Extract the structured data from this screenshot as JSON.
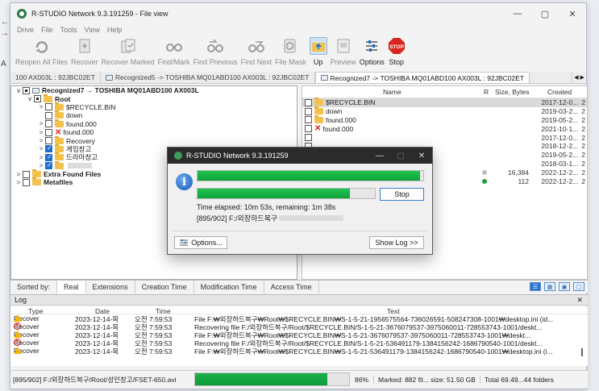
{
  "background": {
    "left_labels": [
      "←",
      "→",
      "A"
    ]
  },
  "window": {
    "title": "R-STUDIO Network 9.3.191259 - File view",
    "controls": {
      "min": "—",
      "max": "▢",
      "close": "✕"
    }
  },
  "menu": [
    "Drive",
    "File",
    "Tools",
    "View",
    "Help"
  ],
  "toolbar": [
    {
      "label": "Reopen All Files",
      "icon": "reopen-icon",
      "enabled": false
    },
    {
      "label": "Recover",
      "icon": "recover-icon",
      "enabled": false
    },
    {
      "label": "Recover Marked",
      "icon": "recover-marked-icon",
      "enabled": false
    },
    {
      "label": "Find/Mark",
      "icon": "find-mark-icon",
      "enabled": false
    },
    {
      "label": "Find Previous",
      "icon": "find-previous-icon",
      "enabled": false
    },
    {
      "label": "Find Next",
      "icon": "find-next-icon",
      "enabled": false
    },
    {
      "label": "File Mask",
      "icon": "file-mask-icon",
      "enabled": false
    },
    {
      "label": "Up",
      "icon": "up-folder-icon",
      "enabled": true
    },
    {
      "label": "Preview",
      "icon": "preview-icon",
      "enabled": false
    },
    {
      "label": "Options",
      "icon": "options-icon",
      "enabled": true
    },
    {
      "label": "Stop",
      "icon": "stop-icon",
      "enabled": true
    }
  ],
  "tabs": [
    {
      "label": "100 AX003L : 92JBC02ET",
      "active": false
    },
    {
      "label": "Recognized5 -> TOSHIBA MQ01ABD100 AX003L : 92JBC02ET",
      "active": false
    },
    {
      "label": "Recognized7 -> TOSHIBA MQ01ABD100 AX003L : 92JBC02ET",
      "active": true
    }
  ],
  "tab_nav": "◀ ▶",
  "tree": [
    {
      "label": "Recognized7 → TOSHIBA MQ01ABD100 AX003L",
      "indent": 0,
      "expander": "∨",
      "check": "part",
      "type": "drive",
      "bold": true
    },
    {
      "label": "Root",
      "indent": 1,
      "expander": "∨",
      "check": "part",
      "type": "folder",
      "bold": true
    },
    {
      "label": "$RECYCLE.BIN",
      "indent": 2,
      "expander": ">",
      "check": "none",
      "type": "folder"
    },
    {
      "label": "down",
      "indent": 2,
      "expander": "",
      "check": "none",
      "type": "folder"
    },
    {
      "label": "found.000",
      "indent": 2,
      "expander": ">",
      "check": "none",
      "type": "folder"
    },
    {
      "label": "found.000",
      "indent": 2,
      "expander": ">",
      "check": "none",
      "type": "deleted"
    },
    {
      "label": "Recovery",
      "indent": 2,
      "expander": ">",
      "check": "none",
      "type": "folder"
    },
    {
      "label": "게임창고",
      "indent": 2,
      "expander": ">",
      "check": "checked",
      "type": "folder"
    },
    {
      "label": "드라마창고",
      "indent": 2,
      "expander": ">",
      "check": "checked",
      "type": "folder"
    },
    {
      "label": "",
      "indent": 2,
      "expander": ">",
      "check": "checked",
      "type": "folder-blur"
    },
    {
      "label": "Extra Found Files",
      "indent": 0,
      "expander": ">",
      "check": "none",
      "type": "folder",
      "bold": true
    },
    {
      "label": "Metafiles",
      "indent": 0,
      "expander": ">",
      "check": "none",
      "type": "folder",
      "bold": true
    }
  ],
  "columns": {
    "name": "Name",
    "r": "R",
    "size": "Size, Bytes",
    "created": "Created"
  },
  "files": [
    {
      "name": "$RECYCLE.BIN",
      "size": "",
      "created": "2017-12-0...",
      "extra": "2",
      "type": "folder",
      "selected": true
    },
    {
      "name": "down",
      "size": "",
      "created": "2019-03-2...",
      "extra": "2",
      "type": "folder"
    },
    {
      "name": "found.000",
      "size": "",
      "created": "2019-05-2...",
      "extra": "2",
      "type": "folder"
    },
    {
      "name": "found.000",
      "size": "",
      "created": "2021-10-1...",
      "extra": "2",
      "type": "deleted"
    },
    {
      "name": "",
      "size": "",
      "created": "2017-12-0...",
      "extra": "2",
      "type": "hidden"
    },
    {
      "name": "",
      "size": "",
      "created": "2018-12-2...",
      "extra": "2",
      "type": "hidden"
    },
    {
      "name": "",
      "size": "",
      "created": "2019-05-2...",
      "extra": "2",
      "type": "hidden"
    },
    {
      "name": "",
      "size": "",
      "created": "2018-03-1...",
      "extra": "2",
      "type": "hidden"
    },
    {
      "name": "",
      "size": "16,384",
      "created": "2022-12-2...",
      "extra": "2",
      "type": "file",
      "dot": "#bbbbbb"
    },
    {
      "name": "",
      "size": "112",
      "created": "2022-12-2...",
      "extra": "2",
      "type": "file",
      "dot": "#1aa13f"
    }
  ],
  "sort": {
    "label": "Sorted by:",
    "options": [
      "Real",
      "Extensions",
      "Creation Time",
      "Modification Time",
      "Access Time"
    ],
    "active": "Real"
  },
  "view_modes": [
    "☰",
    "▦",
    "▣",
    "▢"
  ],
  "log": {
    "title": "Log",
    "close": "✕",
    "headers": {
      "type": "Type",
      "date": "Date",
      "time": "Time",
      "text": "Text"
    },
    "rows": [
      {
        "icon": "warn",
        "type": "Recover",
        "date": "2023-12-14-목",
        "time": "오전 7:59:53",
        "text": "File F:₩외장하드복구₩Root₩$RECYCLE.BIN₩S-1-5-21-1956575564-736026591-508247308-1001₩desktop.ini (id..."
      },
      {
        "icon": "err",
        "type": "Recover",
        "date": "2023-12-14-목",
        "time": "오전 7:59:53",
        "text": "Recovering file F:/외장하드복구/Root/$RECYCLE.BIN/S-1-5-21-3676079537-3975060011-728553743-1001/deskt..."
      },
      {
        "icon": "warn",
        "type": "Recover",
        "date": "2023-12-14-목",
        "time": "오전 7:59:53",
        "text": "File F:₩외장하드복구₩Root₩$RECYCLE.BIN₩S-1-5-21-3676079537-3975060011-728553743-1001₩deskt..."
      },
      {
        "icon": "err",
        "type": "Recover",
        "date": "2023-12-14-목",
        "time": "오전 7:59:53",
        "text": "Recovering file F:/외장하드복구/Root/$RECYCLE.BIN/S-1-5-21-536491179-1384156242-1686790540-1001/deskt..."
      },
      {
        "icon": "warn",
        "type": "Recover",
        "date": "2023-12-14-목",
        "time": "오전 7:59:53",
        "text": "File F:₩외장하드복구₩Root₩$RECYCLE.BIN₩S-1-5-21-536491179-1384156242-1686790540-1001₩desktop.ini (i..."
      }
    ]
  },
  "status": {
    "path": "[895/902] F:/외장하드복구/Root/성인창고/FSET-650.avi",
    "progress": 0.86,
    "percent": "86%",
    "marked": "Marked: 882 fil... size: 51.50 GB",
    "total": "Total 69.49...44 folders"
  },
  "dialog": {
    "title": "R-STUDIO Network 9.3.191259",
    "controls": {
      "min": "—",
      "max": "▢",
      "close": "✕"
    },
    "bar1_progress": 0.985,
    "bar2_progress": 0.86,
    "stop": "Stop",
    "time_text": "Time elapsed: 10m 53s, remaining: 1m 38s",
    "file_text": "[895/902] F:/외장하드복구",
    "options": "Options...",
    "show_log": "Show Log >>"
  },
  "colors": {
    "accent": "#1e6ed2",
    "progress": "#14a944",
    "dialog_title": "#2b2b2b"
  }
}
